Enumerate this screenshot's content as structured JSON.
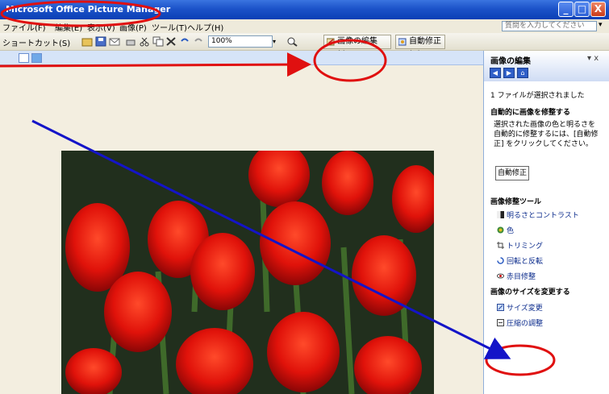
{
  "window": {
    "title": "Microsoft Office Picture Manager",
    "controls": {
      "minimize": "_",
      "maximize": "□",
      "close": "X"
    }
  },
  "menu": {
    "items": [
      "ファイル(F)",
      "編集(E)",
      "表示(V)",
      "画像(P)",
      "ツール(T)",
      "ヘルプ(H)"
    ],
    "help_placeholder": "質問を入力してください"
  },
  "toolbar": {
    "shortcut_label": "ショートカット(S)",
    "zoom_value": "100%",
    "edit_picture_label": "画像の編集(I)...",
    "auto_correct_label": "自動修正(A)"
  },
  "task_pane": {
    "title": "画像の編集",
    "close_label": "▾ x",
    "nav": [
      "◀",
      "▶",
      "⌂"
    ],
    "selection_status": "1 ファイルが選択されました",
    "auto_section": "自動的に画像を修整する",
    "auto_note": "選択された画像の色と明るさを自動的に修整するには、[自動修正] をクリックしてください。",
    "auto_button": "自動修正",
    "tools_section": "画像修整ツール",
    "tools": [
      "明るさとコントラスト",
      "色",
      "トリミング",
      "回転と反転",
      "赤目修整"
    ],
    "size_section": "画像のサイズを変更する",
    "size_links": [
      "サイズ変更",
      "圧縮の調整"
    ]
  },
  "colors": {
    "title_bar": "#1c53c9",
    "annotation_red": "#e01010",
    "annotation_blue": "#1414c8",
    "link": "#0b2b8c"
  }
}
